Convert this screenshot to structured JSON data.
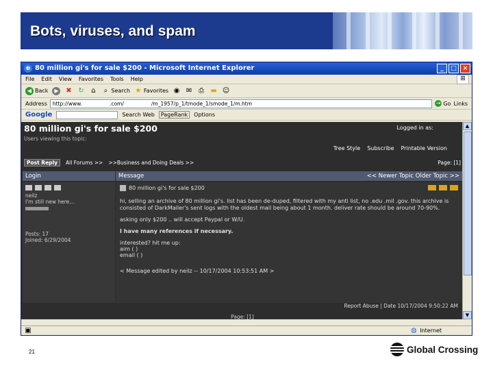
{
  "slide": {
    "title": "Bots, viruses, and spam",
    "number": "21"
  },
  "browser": {
    "window_title": "80 million gi's for sale $200 - Microsoft Internet Explorer",
    "menu": [
      "File",
      "Edit",
      "View",
      "Favorites",
      "Tools",
      "Help"
    ],
    "toolbar": {
      "back": "Back",
      "search": "Search",
      "favorites": "Favorites"
    },
    "address": {
      "label": "Address",
      "url_part1": "http://www.",
      "url_part2": ".com/",
      "url_part3": "/m_1957/p_1/tmode_1/smode_1/m.htm",
      "go": "Go",
      "links": "Links"
    },
    "google": {
      "logo": "Google",
      "search_web": "Search Web",
      "pagerank": "PageRank",
      "options": "Options"
    },
    "status": {
      "zone": "Internet"
    }
  },
  "forum": {
    "topic_title": "80 million gi's for sale $200",
    "logged_in": "Logged in as:",
    "viewing": "Users viewing this topic:",
    "options": [
      "Tree Style",
      "Subscribe",
      "Printable Version"
    ],
    "post_reply": "Post Reply",
    "breadcrumb_forums": "All Forums >>",
    "breadcrumb_section": ">>Business and Doing Deals >>",
    "page": "Page: [1]",
    "col_login": "Login",
    "col_message": "Message",
    "topic_nav": "<< Newer Topic  Older Topic >>",
    "user": {
      "name": "neilz",
      "rank": "I'm still new here...",
      "posts": "Posts: 17",
      "joined": "Joined: 6/29/2004"
    },
    "message": {
      "subject": "80 million gi's for sale $200",
      "paragraph1": "hi, selling an archive of 80 million gi's. list has been de-duped, filtered with my anti list, no .edu .mil .gov. this archive is consisted of DarkMailer's sent logs with the oldest mail being about 1 month. deliver rate should be around 70-90%.",
      "paragraph2": "asking only $200 .. will accept Paypal or W/U.",
      "paragraph3": "I have many references if necessary.",
      "contact_intro": "interested? hit me up:",
      "contact_aim": "aim (                  )",
      "contact_email": "email (                    )",
      "edited": "< Message edited by neilz -- 10/17/2004 10:53:51 AM >"
    },
    "post_footer": "Report Abuse  |  Date 10/17/2004 9:50:22 AM",
    "pages_bottom": "Page:  [1]"
  },
  "footer": {
    "company": "Global Crossing"
  },
  "colors": {
    "header_bg": "#1c3a8e",
    "forum_bg": "#2d2d2d",
    "table_header": "#505a70"
  }
}
